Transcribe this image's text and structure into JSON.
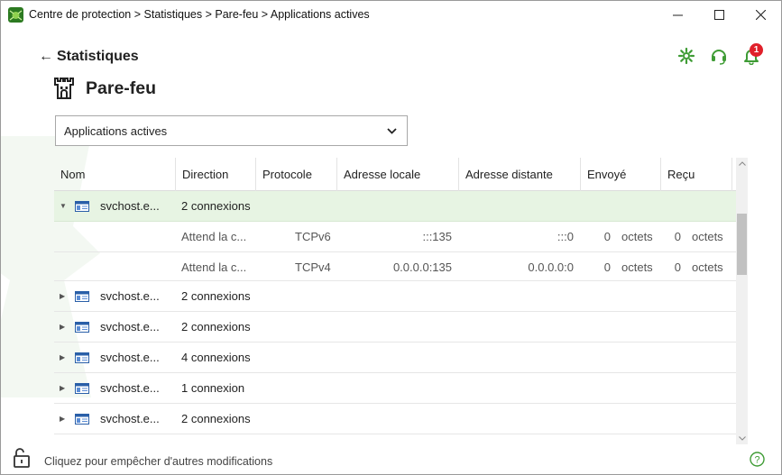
{
  "titlebar": {
    "title": "Centre de protection > Statistiques > Pare-feu > Applications actives",
    "icons": {
      "app": "drweb-spider-icon",
      "minimize": "minimize-icon",
      "maximize": "maximize-icon",
      "close": "close-icon"
    }
  },
  "header": {
    "back_arrow": "🡐",
    "back_label": "Statistiques",
    "page_title": "Pare-feu",
    "notification_count": "1",
    "accent_color": "#3f9c35"
  },
  "view_selector": {
    "selected": "Applications actives"
  },
  "table": {
    "columns": [
      "Nom",
      "Direction",
      "Protocole",
      "Adresse locale",
      "Adresse distante",
      "Envoyé",
      "Reçu"
    ],
    "rows": [
      {
        "expanded": true,
        "caret": "▼",
        "name": "svchost.e...",
        "direction": "2 connexions"
      },
      {
        "child": true,
        "direction": "Attend la c...",
        "protocol": "TCPv6",
        "local": ":::135",
        "remote": ":::0",
        "sent_value": "0",
        "sent_unit": "octets",
        "recv_value": "0",
        "recv_unit": "octets"
      },
      {
        "child": true,
        "direction": "Attend la c...",
        "protocol": "TCPv4",
        "local": "0.0.0.0:135",
        "remote": "0.0.0.0:0",
        "sent_value": "0",
        "sent_unit": "octets",
        "recv_value": "0",
        "recv_unit": "octets"
      },
      {
        "expanded": false,
        "caret": "▶",
        "name": "svchost.e...",
        "direction": "2 connexions"
      },
      {
        "expanded": false,
        "caret": "▶",
        "name": "svchost.e...",
        "direction": "2 connexions"
      },
      {
        "expanded": false,
        "caret": "▶",
        "name": "svchost.e...",
        "direction": "4 connexions"
      },
      {
        "expanded": false,
        "caret": "▶",
        "name": "svchost.e...",
        "direction": "1 connexion"
      },
      {
        "expanded": false,
        "caret": "▶",
        "name": "svchost.e...",
        "direction": "2 connexions"
      }
    ]
  },
  "footer": {
    "lock_text": "Cliquez pour empêcher d'autres modifications",
    "help": "?"
  }
}
